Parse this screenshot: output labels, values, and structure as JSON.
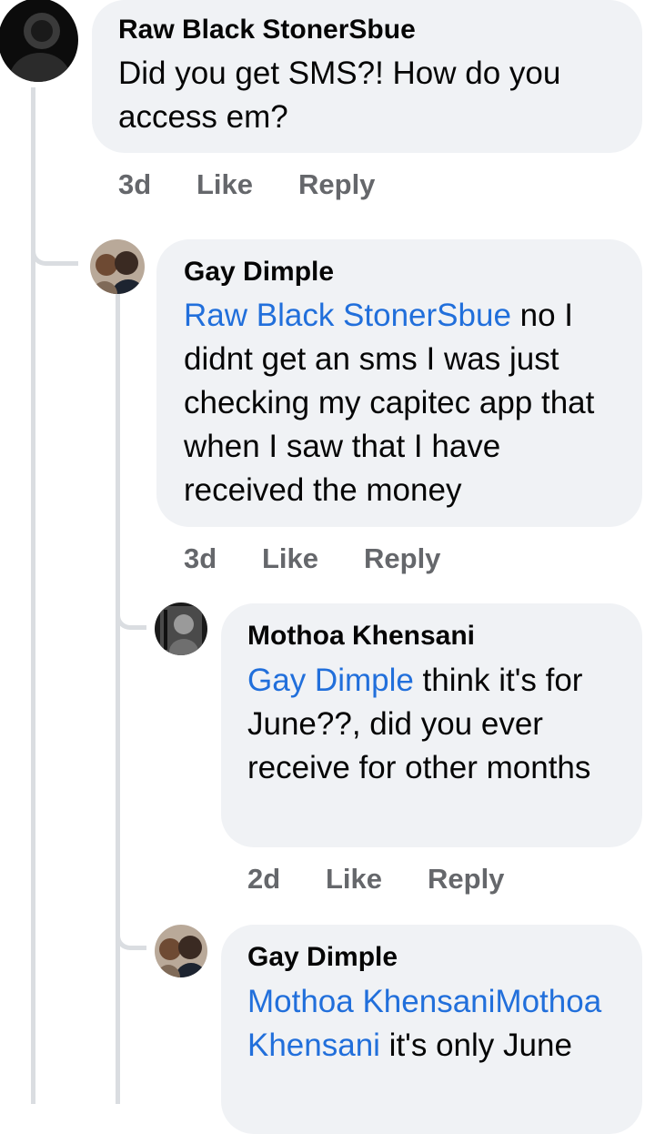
{
  "comments": [
    {
      "author": "Raw Black StonerSbue",
      "mention": "",
      "text": "Did you get SMS?! How do you access em?",
      "time": "3d",
      "like_label": "Like",
      "reply_label": "Reply"
    },
    {
      "author": "Gay Dimple",
      "mention": "Raw Black StonerSbue",
      "text": " no I didnt get an sms I was just checking my capitec app that when I saw that I have received the money",
      "time": "3d",
      "like_label": "Like",
      "reply_label": "Reply"
    },
    {
      "author": "Mothoa Khensani",
      "mention": "Gay Dimple",
      "text": " think it's for June??, did you ever receive for other months",
      "time": "2d",
      "like_label": "Like",
      "reply_label": "Reply"
    },
    {
      "author": "Gay Dimple",
      "mention": "Mothoa KhensaniMothoa Khensani",
      "text": " it's only June"
    }
  ],
  "colors": {
    "bubble": "#f0f2f5",
    "mention": "#216fdb",
    "meta": "#65676b",
    "thread_line": "#dadde1"
  }
}
